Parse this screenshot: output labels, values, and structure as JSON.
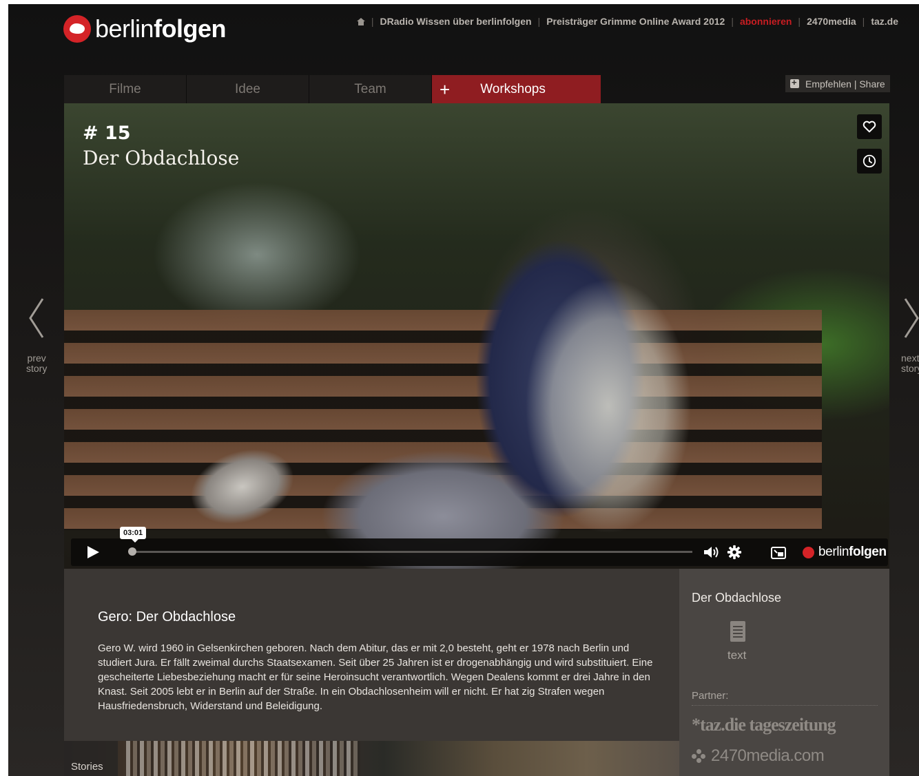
{
  "brand": {
    "name_light": "berlin",
    "name_bold": "folgen"
  },
  "top_nav": {
    "items": [
      "DRadio Wissen über berlinfolgen",
      "Preisträger Grimme Online Award 2012",
      "abonnieren",
      "2470media",
      "taz.de"
    ]
  },
  "tabs": [
    "Filme",
    "Idee",
    "Team",
    "Workshops"
  ],
  "share_label": "Empfehlen | Share",
  "episode": {
    "number": "# 15",
    "title": "Der Obdachlose"
  },
  "player": {
    "time": "03:01",
    "progress": 0.0,
    "logo_light": "berlin",
    "logo_bold": "folgen"
  },
  "nav_arrows": {
    "prev_line1": "prev",
    "prev_line2": "story",
    "next_line1": "next",
    "next_line2": "story"
  },
  "description": {
    "heading": "Gero: Der Obdachlose",
    "body": "Gero W. wird 1960 in Gelsenkirchen geboren. Nach dem Abitur, das er mit 2,0 besteht, geht er 1978 nach Berlin und studiert Jura. Er fällt zweimal durchs Staatsexamen. Seit über 25 Jahren ist er drogenabhängig und wird substituiert. Eine gescheiterte Liebesbeziehung macht er für seine Heroinsucht verantwortlich. Wegen Dealens kommt er drei Jahre in den Knast. Seit 2005 lebt er in Berlin auf der Straße. In ein Obdachlosenheim will er nicht. Er hat zig Strafen wegen Hausfriedensbruch, Widerstand und Beleidigung."
  },
  "sidebar": {
    "title": "Der Obdachlose",
    "doc_label": "text",
    "partner_label": "Partner:",
    "partner1": "*taz.die tageszeitung",
    "partner2": "2470media.com"
  },
  "stories_label": "Stories",
  "colors": {
    "accent": "#8f1d21",
    "logo_red": "#d42327",
    "link_hot": "#c81d22"
  }
}
